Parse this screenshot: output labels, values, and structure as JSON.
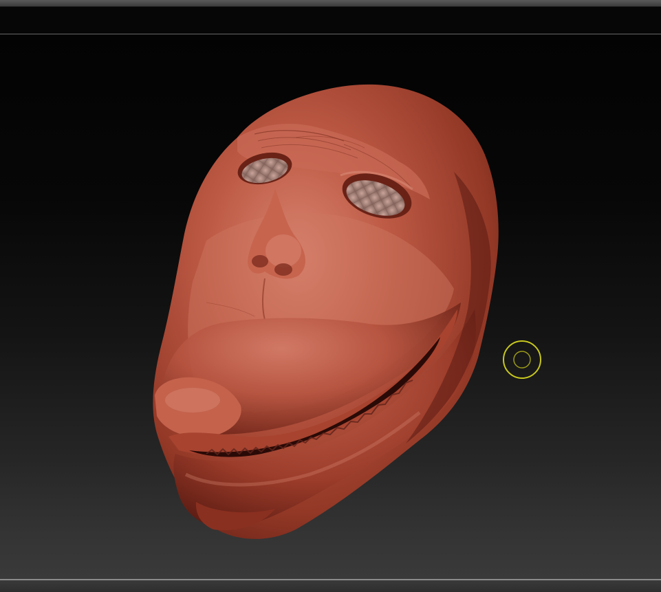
{
  "app": {
    "kind": "3d-sculpting-viewport"
  },
  "viewport": {
    "model_name_visible": "",
    "colors": {
      "material": "#b04a38",
      "material_highlight": "#d98470",
      "material_shadow": "#5a1a12",
      "background_top": "#030303",
      "background_bottom": "#3a3a3a"
    }
  },
  "cursor": {
    "icon": "brush-cursor-ring-icon",
    "color": "#c8c81e"
  },
  "model": {
    "icon": "sculpted-head-mesh",
    "features": [
      "eye-socket-left",
      "eye-socket-right",
      "nose",
      "brow",
      "snout",
      "upper-lip",
      "mouth-opening",
      "lower-jaw"
    ]
  }
}
